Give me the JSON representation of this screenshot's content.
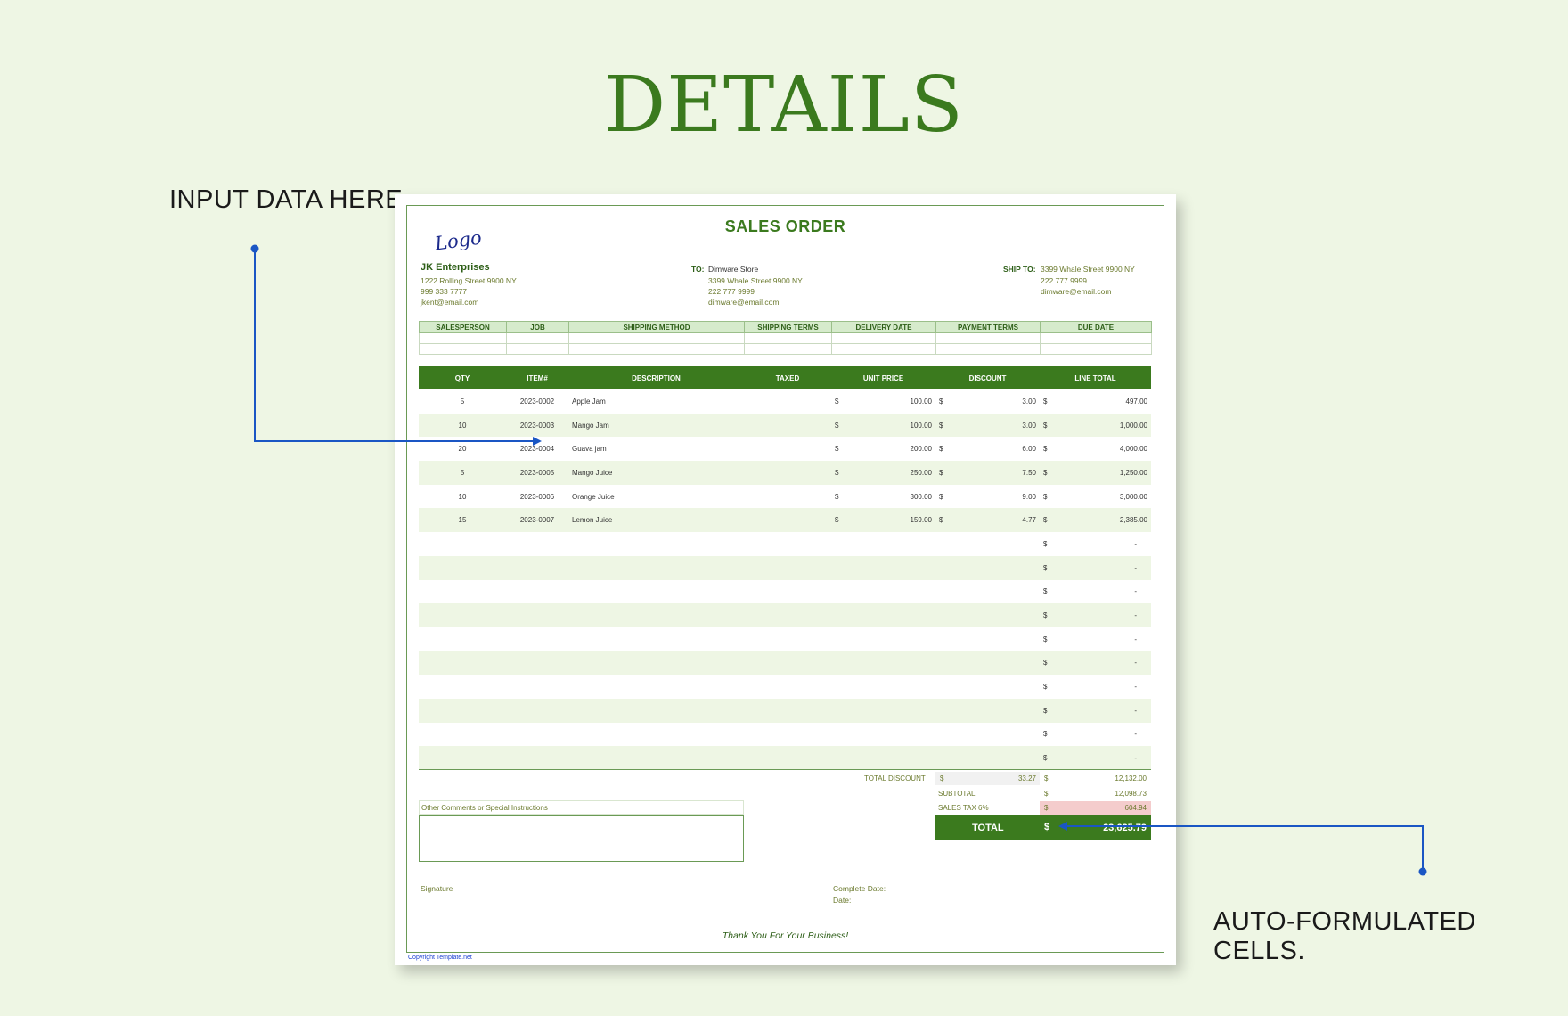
{
  "hero_title": "DETAILS",
  "callouts": {
    "left": "INPUT DATA HERE.",
    "right": "AUTO-FORMULATED CELLS."
  },
  "sheet": {
    "title": "SALES ORDER",
    "logo": "Logo",
    "company": {
      "name": "JK Enterprises",
      "address": "1222 Rolling Street 9900 NY",
      "phone": "999 333 7777",
      "email": "jkent@email.com"
    },
    "to": {
      "label": "TO:",
      "name": "Dimware Store",
      "address": "3399 Whale Street 9900 NY",
      "phone": "222 777 9999",
      "email": "dimware@email.com"
    },
    "ship_to": {
      "label": "SHIP TO:",
      "address": "3399 Whale Street 9900 NY",
      "phone": "222 777 9999",
      "email": "dimware@email.com"
    },
    "info_headers": [
      "SALESPERSON",
      "JOB",
      "SHIPPING METHOD",
      "SHIPPING TERMS",
      "DELIVERY DATE",
      "PAYMENT TERMS",
      "DUE DATE"
    ],
    "item_headers": [
      "QTY",
      "ITEM#",
      "DESCRIPTION",
      "TAXED",
      "UNIT PRICE",
      "DISCOUNT",
      "LINE TOTAL"
    ],
    "currency": "$",
    "items": [
      {
        "qty": "5",
        "item": "2023-0002",
        "desc": "Apple Jam",
        "taxed": "",
        "unit_cur": "$",
        "unit": "100.00",
        "disc_cur": "$",
        "disc": "3.00",
        "total_cur": "$",
        "total": "497.00"
      },
      {
        "qty": "10",
        "item": "2023-0003",
        "desc": "Mango Jam",
        "taxed": "",
        "unit_cur": "$",
        "unit": "100.00",
        "disc_cur": "$",
        "disc": "3.00",
        "total_cur": "$",
        "total": "1,000.00"
      },
      {
        "qty": "20",
        "item": "2023-0004",
        "desc": "Guava jam",
        "taxed": "",
        "unit_cur": "$",
        "unit": "200.00",
        "disc_cur": "$",
        "disc": "6.00",
        "total_cur": "$",
        "total": "4,000.00"
      },
      {
        "qty": "5",
        "item": "2023-0005",
        "desc": "Mango Juice",
        "taxed": "",
        "unit_cur": "$",
        "unit": "250.00",
        "disc_cur": "$",
        "disc": "7.50",
        "total_cur": "$",
        "total": "1,250.00"
      },
      {
        "qty": "10",
        "item": "2023-0006",
        "desc": "Orange Juice",
        "taxed": "",
        "unit_cur": "$",
        "unit": "300.00",
        "disc_cur": "$",
        "disc": "9.00",
        "total_cur": "$",
        "total": "3,000.00"
      },
      {
        "qty": "15",
        "item": "2023-0007",
        "desc": "Lemon Juice",
        "taxed": "",
        "unit_cur": "$",
        "unit": "159.00",
        "disc_cur": "$",
        "disc": "4.77",
        "total_cur": "$",
        "total": "2,385.00"
      },
      {
        "qty": "",
        "item": "",
        "desc": "",
        "taxed": "",
        "unit_cur": "",
        "unit": "",
        "disc_cur": "",
        "disc": "",
        "total_cur": "$",
        "total": "-"
      },
      {
        "qty": "",
        "item": "",
        "desc": "",
        "taxed": "",
        "unit_cur": "",
        "unit": "",
        "disc_cur": "",
        "disc": "",
        "total_cur": "$",
        "total": "-"
      },
      {
        "qty": "",
        "item": "",
        "desc": "",
        "taxed": "",
        "unit_cur": "",
        "unit": "",
        "disc_cur": "",
        "disc": "",
        "total_cur": "$",
        "total": "-"
      },
      {
        "qty": "",
        "item": "",
        "desc": "",
        "taxed": "",
        "unit_cur": "",
        "unit": "",
        "disc_cur": "",
        "disc": "",
        "total_cur": "$",
        "total": "-"
      },
      {
        "qty": "",
        "item": "",
        "desc": "",
        "taxed": "",
        "unit_cur": "",
        "unit": "",
        "disc_cur": "",
        "disc": "",
        "total_cur": "$",
        "total": "-"
      },
      {
        "qty": "",
        "item": "",
        "desc": "",
        "taxed": "",
        "unit_cur": "",
        "unit": "",
        "disc_cur": "",
        "disc": "",
        "total_cur": "$",
        "total": "-"
      },
      {
        "qty": "",
        "item": "",
        "desc": "",
        "taxed": "",
        "unit_cur": "",
        "unit": "",
        "disc_cur": "",
        "disc": "",
        "total_cur": "$",
        "total": "-"
      },
      {
        "qty": "",
        "item": "",
        "desc": "",
        "taxed": "",
        "unit_cur": "",
        "unit": "",
        "disc_cur": "",
        "disc": "",
        "total_cur": "$",
        "total": "-"
      },
      {
        "qty": "",
        "item": "",
        "desc": "",
        "taxed": "",
        "unit_cur": "",
        "unit": "",
        "disc_cur": "",
        "disc": "",
        "total_cur": "$",
        "total": "-"
      },
      {
        "qty": "",
        "item": "",
        "desc": "",
        "taxed": "",
        "unit_cur": "",
        "unit": "",
        "disc_cur": "",
        "disc": "",
        "total_cur": "$",
        "total": "-"
      }
    ],
    "totals": {
      "total_discount_label": "TOTAL DISCOUNT",
      "total_discount": "33.27",
      "total_discount_line": "12,132.00",
      "subtotal_label": "SUBTOTAL",
      "subtotal": "12,098.73",
      "sales_tax_label": "SALES TAX 6%",
      "sales_tax": "604.94",
      "total_label": "TOTAL",
      "total": "23,625.79"
    },
    "comments_label": "Other Comments or Special Instructions",
    "signature_label": "Signature",
    "complete_date_label": "Complete Date:",
    "date_label": "Date:",
    "thanks": "Thank You For Your Business!",
    "copyright": "Copyright Template.net"
  },
  "colors": {
    "background": "#eef6e4",
    "primary_green": "#3b7a1e",
    "header_light_green": "#d6ebcc",
    "arrow_blue": "#1a56c4",
    "sales_tax_pink": "#f4cccc"
  }
}
